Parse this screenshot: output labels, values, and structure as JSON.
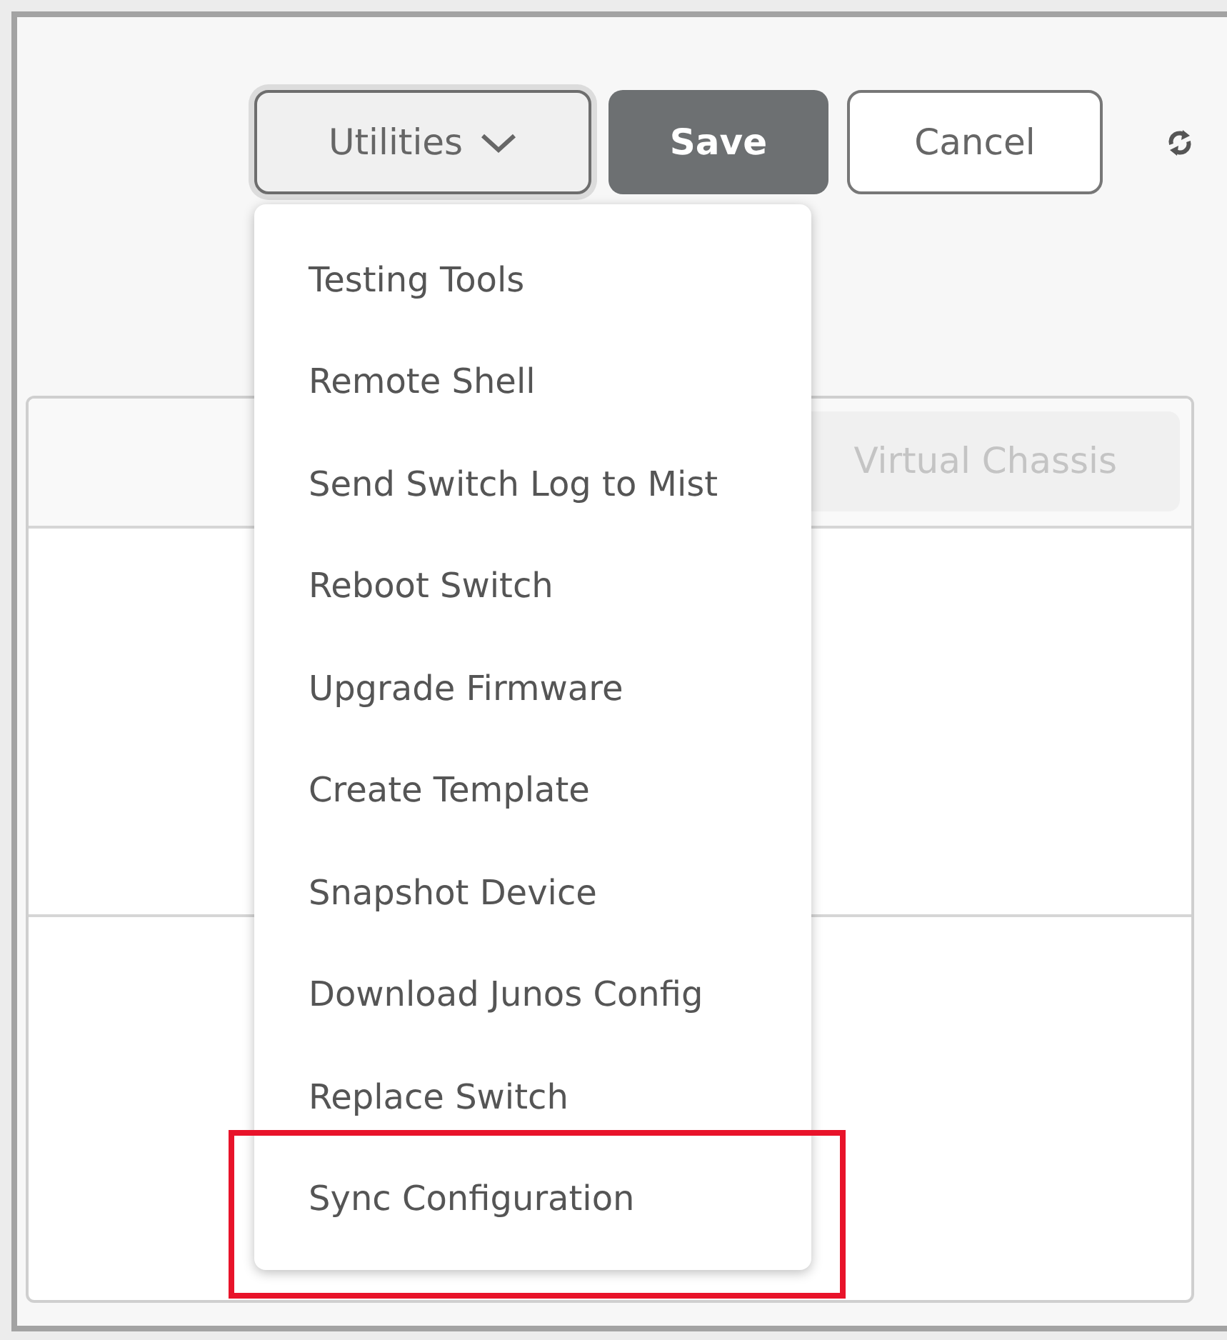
{
  "toolbar": {
    "buttons": [
      {
        "label": "Utilities",
        "kind": "dropdown",
        "expanded": true
      },
      {
        "label": "Save",
        "kind": "primary"
      },
      {
        "label": "Cancel",
        "kind": "outline"
      }
    ]
  },
  "panel": {
    "header_button": "Virtual Chassis"
  },
  "utilities_menu": [
    {
      "label": "Testing Tools",
      "annotated": false
    },
    {
      "label": "Remote Shell",
      "annotated": false
    },
    {
      "label": "Send Switch Log to Mist",
      "annotated": false
    },
    {
      "label": "Reboot Switch",
      "annotated": false
    },
    {
      "label": "Upgrade Firmware",
      "annotated": false
    },
    {
      "label": "Create Template",
      "annotated": false
    },
    {
      "label": "Snapshot Device",
      "annotated": false
    },
    {
      "label": "Download Junos Config",
      "annotated": false
    },
    {
      "label": "Replace Switch",
      "annotated": false
    },
    {
      "label": "Sync Configuration",
      "annotated": true
    }
  ]
}
